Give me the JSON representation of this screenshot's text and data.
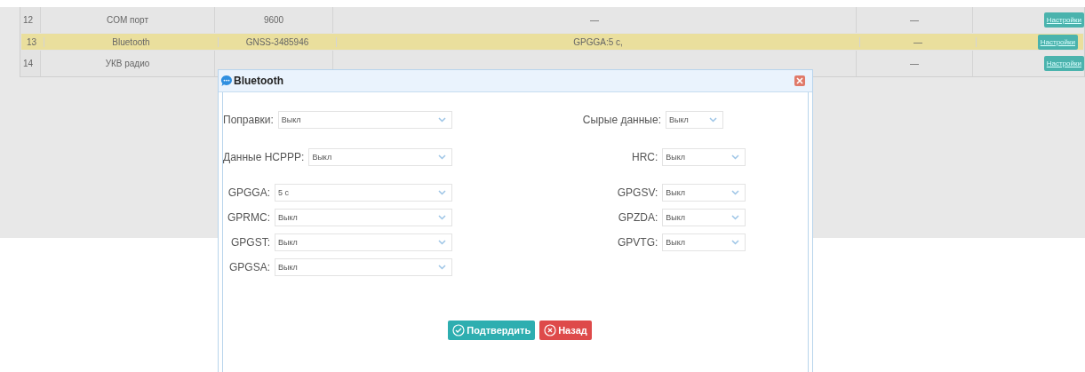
{
  "table": {
    "rows": [
      {
        "index": "12",
        "name": "COM порт",
        "value": "9600",
        "settings": "—",
        "status": "—",
        "button": "Настройки",
        "selected": false
      },
      {
        "index": "13",
        "name": "Bluetooth",
        "value": "GNSS-3485946",
        "settings": "GPGGA:5 с,",
        "status": "—",
        "button": "Настройки",
        "selected": true
      },
      {
        "index": "14",
        "name": "УКВ радио",
        "status": "—",
        "button": "Настройки",
        "selected": false
      }
    ]
  },
  "dialog": {
    "title": "Bluetooth",
    "rows": [
      {
        "left": {
          "label": "Поправки:",
          "value": "Выкл"
        },
        "right": {
          "label": "Сырые данные:",
          "value": "Выкл"
        }
      },
      {
        "left": {
          "label": "Данные HCPPP:",
          "value": "Выкл"
        },
        "right": {
          "label": "HRC:",
          "value": "Выкл"
        }
      },
      {
        "left": {
          "label": "GPGGA:",
          "value": "5 с"
        },
        "right": {
          "label": "GPGSV:",
          "value": "Выкл"
        }
      },
      {
        "left": {
          "label": "GPRMC:",
          "value": "Выкл"
        },
        "right": {
          "label": "GPZDA:",
          "value": "Выкл"
        }
      },
      {
        "left": {
          "label": "GPGST:",
          "value": "Выкл"
        },
        "right": {
          "label": "GPVTG:",
          "value": "Выкл"
        }
      },
      {
        "left": {
          "label": "GPGSA:",
          "value": "Выкл"
        }
      }
    ],
    "buttons": [
      {
        "kind": "confirm",
        "label": "Подтвердить"
      },
      {
        "kind": "back",
        "label": "Назад"
      }
    ]
  }
}
